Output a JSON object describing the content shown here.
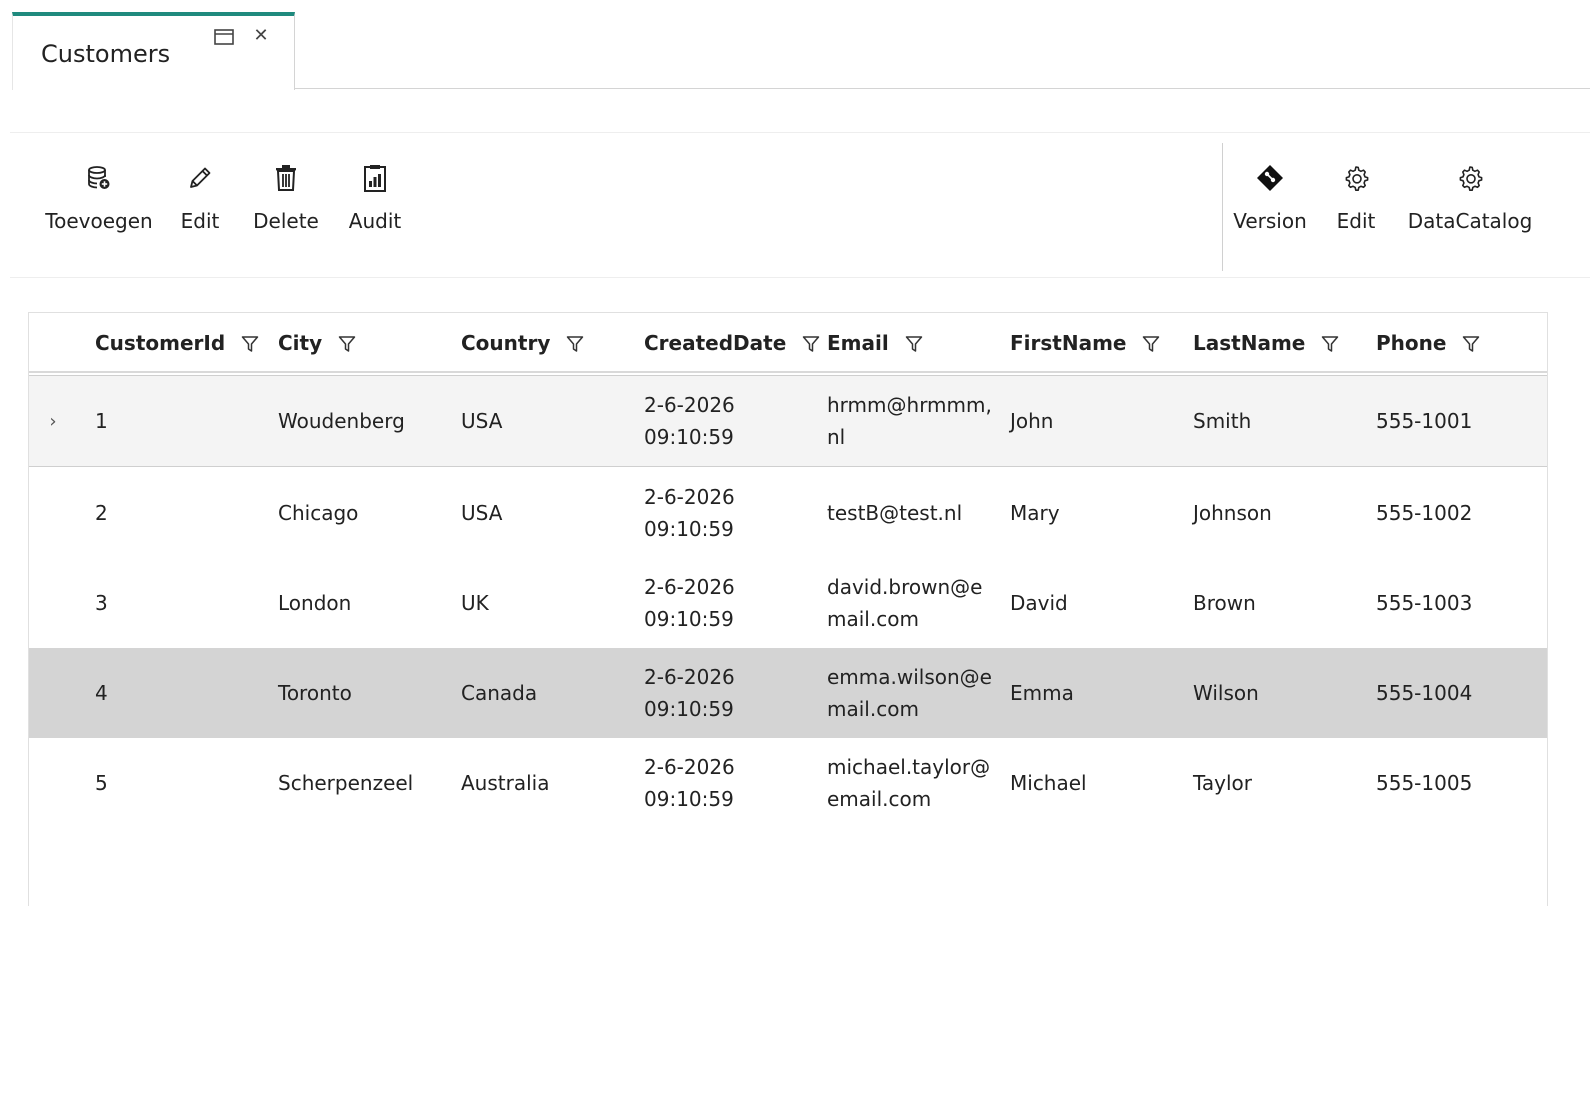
{
  "tab": {
    "title": "Customers"
  },
  "toolbar": {
    "left": [
      {
        "label": "Toevoegen",
        "icon": "database-add-icon"
      },
      {
        "label": "Edit",
        "icon": "pencil-icon"
      },
      {
        "label": "Delete",
        "icon": "trash-icon"
      },
      {
        "label": "Audit",
        "icon": "report-icon"
      }
    ],
    "right": [
      {
        "label": "Version",
        "icon": "git-diamond-icon"
      },
      {
        "label": "Edit",
        "icon": "gear-icon"
      },
      {
        "label": "DataCatalog",
        "icon": "gear-icon"
      }
    ]
  },
  "grid": {
    "columns": [
      "CustomerId",
      "City",
      "Country",
      "CreatedDate",
      "Email",
      "FirstName",
      "LastName",
      "Phone"
    ],
    "rows": [
      {
        "CustomerId": "1",
        "City": "Woudenberg",
        "Country": "USA",
        "CreatedDate": [
          "2-6-2026",
          "09:10:59"
        ],
        "Email": [
          "hrmm@hrmmm,",
          "nl"
        ],
        "FirstName": "John",
        "LastName": "Smith",
        "Phone": "555-1001"
      },
      {
        "CustomerId": "2",
        "City": "Chicago",
        "Country": "USA",
        "CreatedDate": [
          "2-6-2026",
          "09:10:59"
        ],
        "Email": [
          "testB@test.nl"
        ],
        "FirstName": "Mary",
        "LastName": "Johnson",
        "Phone": "555-1002"
      },
      {
        "CustomerId": "3",
        "City": "London",
        "Country": "UK",
        "CreatedDate": [
          "2-6-2026",
          "09:10:59"
        ],
        "Email": [
          "david.brown@e",
          "mail.com"
        ],
        "FirstName": "David",
        "LastName": "Brown",
        "Phone": "555-1003"
      },
      {
        "CustomerId": "4",
        "City": "Toronto",
        "Country": "Canada",
        "CreatedDate": [
          "2-6-2026",
          "09:10:59"
        ],
        "Email": [
          "emma.wilson@e",
          "mail.com"
        ],
        "FirstName": "Emma",
        "LastName": "Wilson",
        "Phone": "555-1004"
      },
      {
        "CustomerId": "5",
        "City": "Scherpenzeel",
        "Country": "Australia",
        "CreatedDate": [
          "2-6-2026",
          "09:10:59"
        ],
        "Email": [
          "michael.taylor@",
          "email.com"
        ],
        "FirstName": "Michael",
        "LastName": "Taylor",
        "Phone": "555-1005"
      }
    ]
  },
  "colors": {
    "accent": "#1f8a7e",
    "selected_row": "#f4f4f4",
    "hover_row": "#d4d4d4"
  }
}
